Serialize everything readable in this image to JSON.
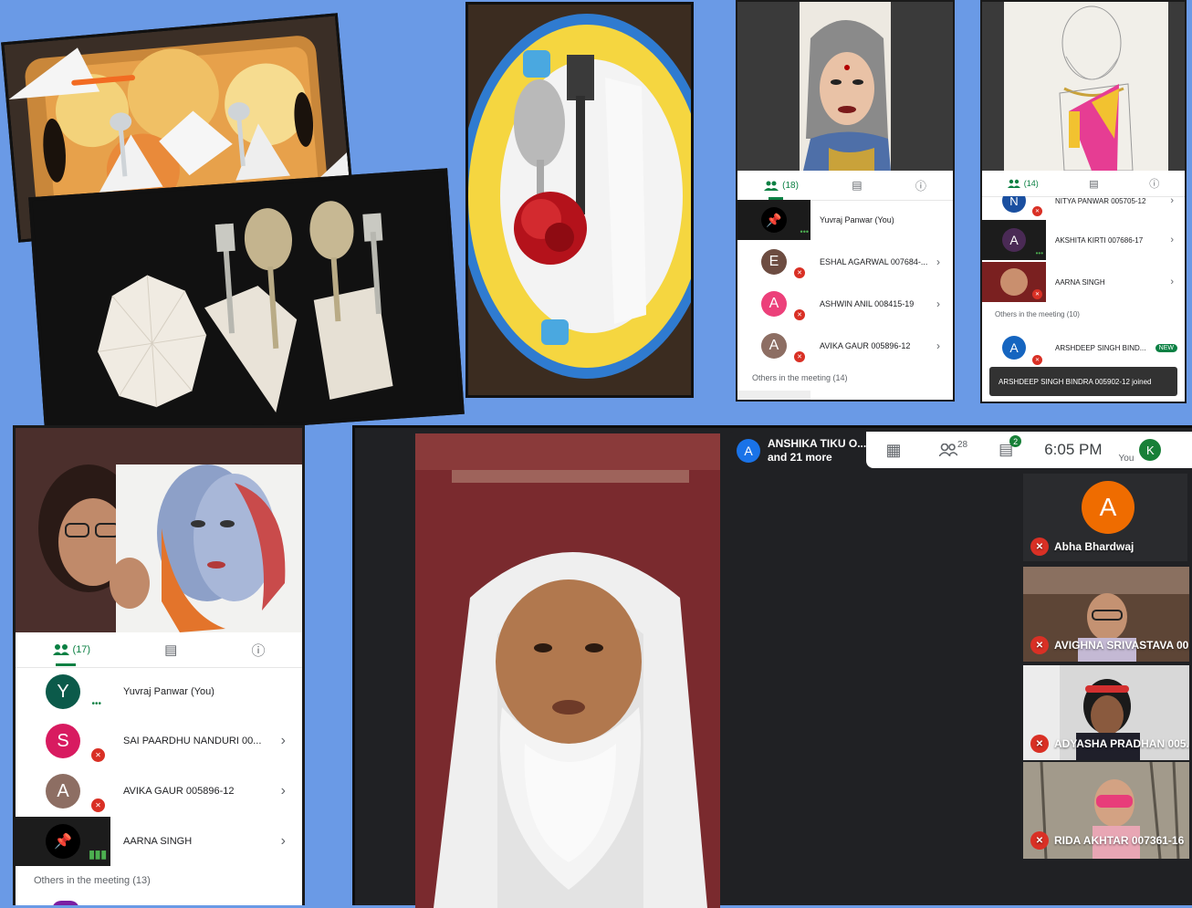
{
  "panel_a": {
    "participants_count": "(18)",
    "rows": [
      {
        "initial": "",
        "name": "Yuvraj Panwar (You)",
        "speaking": true
      },
      {
        "initial": "E",
        "name": "ESHAL AGARWAL 007684-...",
        "color": "#6d4c41"
      },
      {
        "initial": "A",
        "name": "ASHWIN ANIL 008415-19",
        "color": "#ec407a"
      },
      {
        "initial": "A",
        "name": "AVIKA GAUR 005896-12",
        "color": "#8d6e63"
      }
    ],
    "section": "Others in the meeting (14)"
  },
  "panel_b": {
    "participants_count": "(14)",
    "partial_name": "NITYA PANWAR 005705-12",
    "rows": [
      {
        "initial": "A",
        "name": "AKSHITA KIRTI 007686-17"
      },
      {
        "initial": "",
        "name": "AARNA SINGH"
      }
    ],
    "section": "Others in the meeting (10)",
    "new_row": {
      "initial": "A",
      "name": "ARSHDEEP SINGH BIND...",
      "badge": "NEW"
    },
    "toast": "ARSHDEEP SINGH BINDRA 005902-12 joined"
  },
  "panel_c": {
    "participants_count": "(17)",
    "rows": [
      {
        "initial": "Y",
        "name": "Yuvraj Panwar (You)",
        "color": "#0b5a4a"
      },
      {
        "initial": "S",
        "name": "SAI PAARDHU NANDURI 00...",
        "color": "#d81b60"
      },
      {
        "initial": "A",
        "name": "AVIKA GAUR 005896-12",
        "color": "#8d6e63"
      },
      {
        "initial": "",
        "name": "AARNA SINGH"
      }
    ],
    "section": "Others in the meeting (13)"
  },
  "meet": {
    "presenter_initial": "A",
    "presenter_name": "ANSHIKA TIKU O...",
    "presenter_more": "and 21 more",
    "people_count": "28",
    "chat_count": "2",
    "time": "6:05 PM",
    "self_label": "You",
    "self_initial": "K",
    "tiles": [
      {
        "name": "Abha Bhardwaj",
        "initial": "A"
      },
      {
        "name": "AVIGHNA SRIVASTAVA 00..."
      },
      {
        "name": "ADYASHA PRADHAN 005..."
      },
      {
        "name": "RIDA AKHTAR 007361-16"
      }
    ]
  },
  "colors": {
    "background": "#6a9ae6",
    "meet_green": "#0b8043",
    "mic_red": "#d93025",
    "presenter_blue": "#1a73e8",
    "self_green": "#188038"
  }
}
